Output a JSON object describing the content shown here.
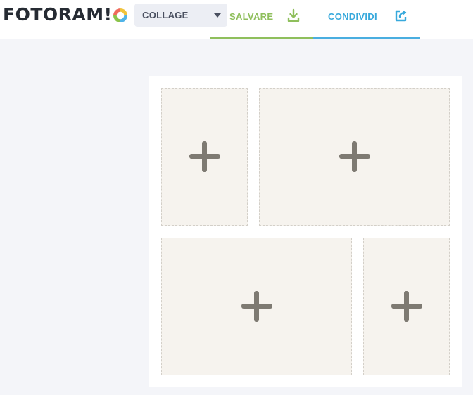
{
  "app": {
    "logo_text": "FOTORAM!",
    "brand_colors": {
      "ring_yellow": "#f0c33c",
      "ring_blue": "#4fb3e8",
      "ring_green": "#8bc34a",
      "ring_red": "#ef6b5b"
    }
  },
  "toolbar": {
    "mode_select": {
      "selected": "COLLAGE",
      "icon": "chevron-down-icon"
    },
    "tabs": [
      {
        "label": "SALVARE",
        "icon": "download-icon",
        "color": "#8fbf5c"
      },
      {
        "label": "CONDIVIDI",
        "icon": "share-icon",
        "color": "#38a9dc"
      }
    ]
  },
  "collage": {
    "layout": "4-slot grid",
    "slots": [
      {
        "slot": "top-left",
        "icon": "plus-icon",
        "state": "empty"
      },
      {
        "slot": "top-right",
        "icon": "plus-icon",
        "state": "empty"
      },
      {
        "slot": "bottom-left",
        "icon": "plus-icon",
        "state": "empty"
      },
      {
        "slot": "bottom-right",
        "icon": "plus-icon",
        "state": "empty"
      }
    ]
  }
}
